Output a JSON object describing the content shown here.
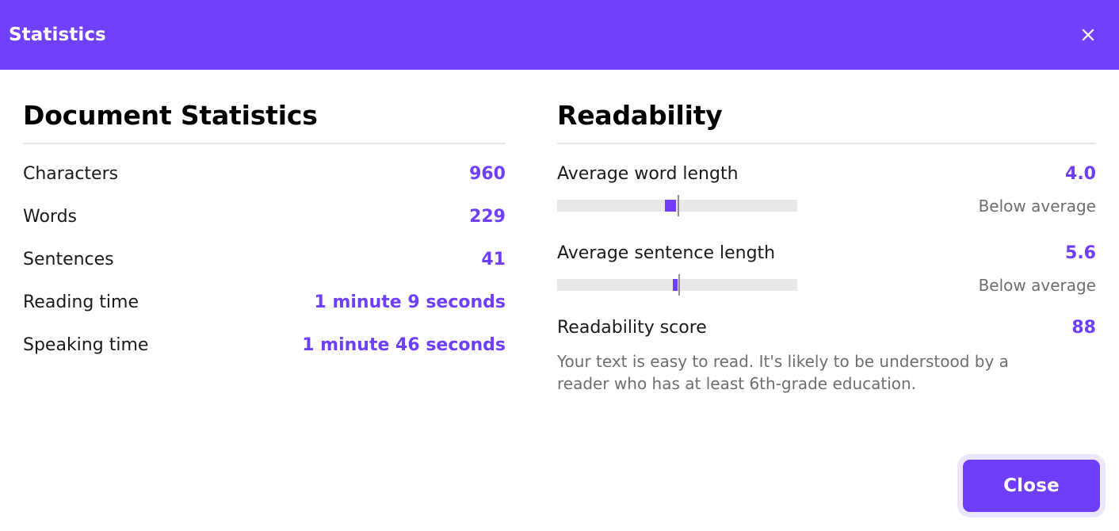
{
  "titlebar": {
    "title": "Statistics",
    "close_icon": "close-icon"
  },
  "document_statistics": {
    "heading": "Document Statistics",
    "rows": [
      {
        "label": "Characters",
        "value": "960"
      },
      {
        "label": "Words",
        "value": "229"
      },
      {
        "label": "Sentences",
        "value": "41"
      },
      {
        "label": "Reading time",
        "value": "1 minute 9 seconds"
      },
      {
        "label": "Speaking time",
        "value": "1 minute 46 seconds"
      }
    ]
  },
  "readability": {
    "heading": "Readability",
    "metrics": [
      {
        "label": "Average word length",
        "value": "4.0",
        "caption": "Below average",
        "fill_start_pct": 45,
        "fill_width_pct": 4.6,
        "tick_pct": 50
      },
      {
        "label": "Average sentence length",
        "value": "5.6",
        "caption": "Below average",
        "fill_start_pct": 48.2,
        "fill_width_pct": 2,
        "tick_pct": 50.5
      }
    ],
    "score": {
      "label": "Readability score",
      "value": "88",
      "description": "Your text is easy to read. It's likely to be understood by a reader who has at least 6th-grade education."
    }
  },
  "footer": {
    "close_label": "Close"
  },
  "colors": {
    "accent": "#6f3efb",
    "titlebar": "#7040fc",
    "muted_text": "#6e6e6e",
    "track": "#e8e8e8",
    "tick": "#909090",
    "rule": "#e6e6e8"
  }
}
